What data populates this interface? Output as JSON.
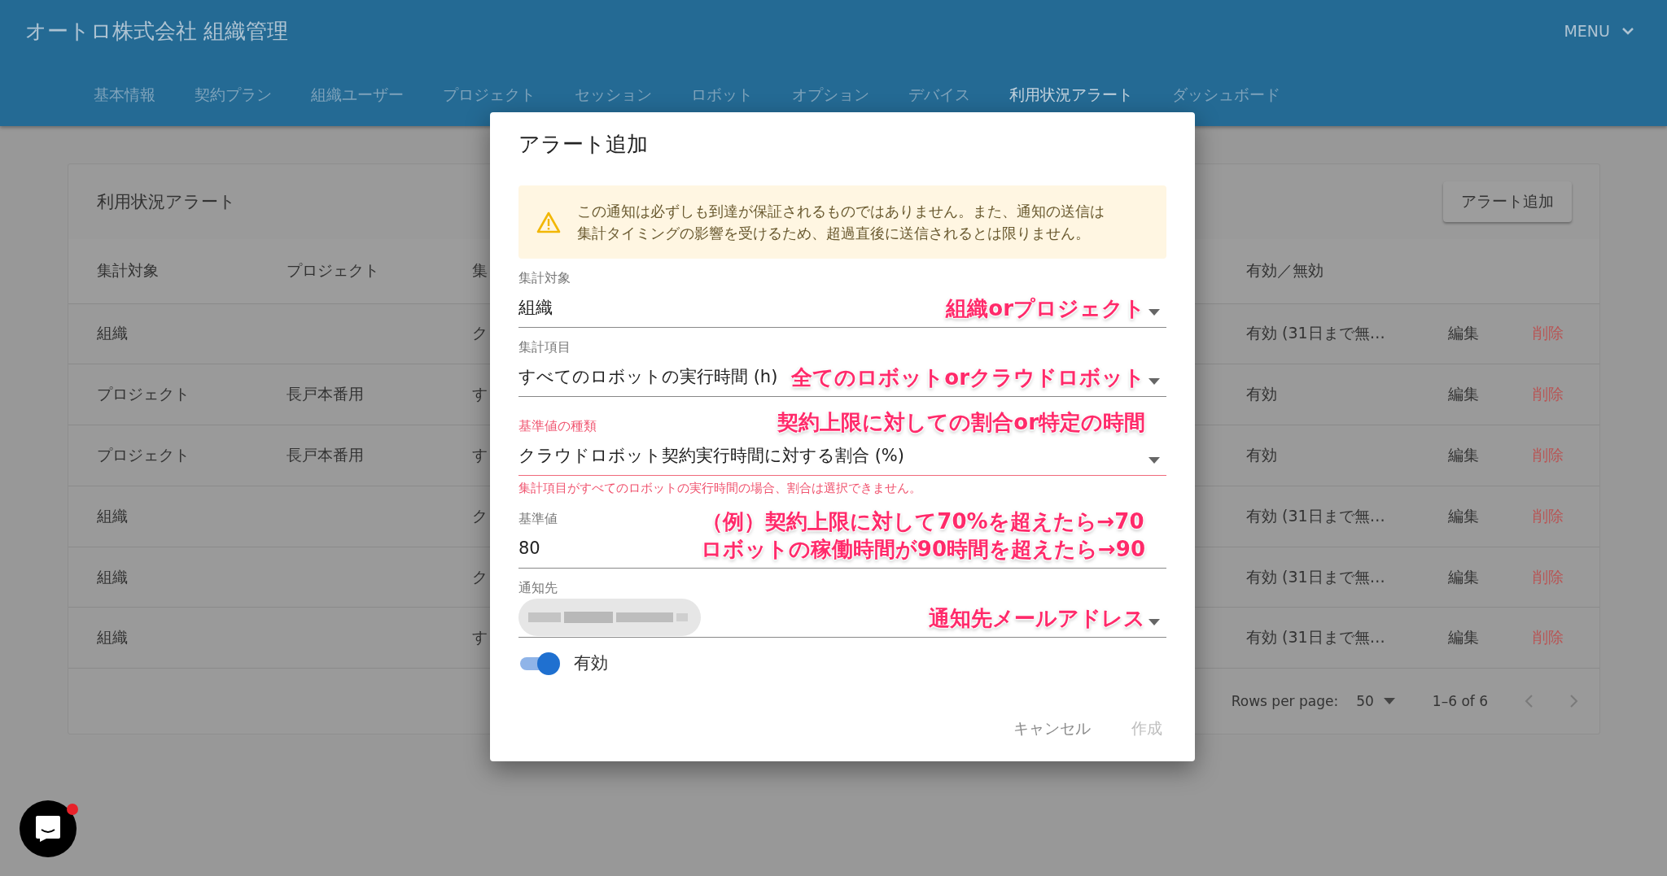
{
  "header": {
    "title": "オートロ株式会社 組織管理",
    "menu": "MENU"
  },
  "tabs": [
    {
      "label": "基本情報",
      "selected": false
    },
    {
      "label": "契約プラン",
      "selected": false
    },
    {
      "label": "組織ユーザー",
      "selected": false
    },
    {
      "label": "プロジェクト",
      "selected": false
    },
    {
      "label": "セッション",
      "selected": false
    },
    {
      "label": "ロボット",
      "selected": false
    },
    {
      "label": "オプション",
      "selected": false
    },
    {
      "label": "デバイス",
      "selected": false
    },
    {
      "label": "利用状況アラート",
      "selected": true
    },
    {
      "label": "ダッシュボード",
      "selected": false
    }
  ],
  "card": {
    "title": "利用状況アラート",
    "add_button": "アラート追加"
  },
  "table": {
    "columns": [
      "集計対象",
      "プロジェクト",
      "集",
      "有効／無効"
    ],
    "rows": [
      {
        "target": "組織",
        "column_3": "ク",
        "status": "有効 (31日まで無…",
        "edit": "編集",
        "delete": "削除"
      },
      {
        "target": "プロジェクト",
        "project": "長戸本番用",
        "column_3": "す",
        "status": "有効",
        "edit": "編集",
        "delete": "削除"
      },
      {
        "target": "プロジェクト",
        "project": "長戸本番用",
        "column_3": "す",
        "status": "有効",
        "edit": "編集",
        "delete": "削除"
      },
      {
        "target": "組織",
        "column_3": "ク",
        "status": "有効 (31日まで無…",
        "edit": "編集",
        "delete": "削除"
      },
      {
        "target": "組織",
        "column_3": "ク",
        "status": "有効 (31日まで無…",
        "edit": "編集",
        "delete": "削除"
      },
      {
        "target": "組織",
        "column_3": "す",
        "status": "有効 (31日まで無…",
        "edit": "編集",
        "delete": "削除"
      }
    ]
  },
  "pagination": {
    "rows_per_page_label": "Rows per page:",
    "rows_per_page": "50",
    "range": "1–6 of 6"
  },
  "dialog": {
    "title": "アラート追加",
    "warning": [
      "この通知は必ずしも到達が保証されるものではありません。また、通知の送信は",
      "集計タイミングの影響を受けるため、超過直後に送信されるとは限りません。"
    ],
    "fields": [
      {
        "kind": "select",
        "label": "集計対象",
        "value": "組織",
        "annotation": [
          "組織orプロジェクト"
        ]
      },
      {
        "kind": "select",
        "label": "集計項目",
        "value": "すべてのロボットの実行時間 (h)",
        "annotation": [
          "全てのロボットorクラウドロボット"
        ]
      },
      {
        "kind": "select",
        "label": "基準値の種類",
        "value": "クラウドロボット契約実行時間に対する割合 (%)",
        "error": "集計項目がすべてのロボットの実行時間の場合、割合は選択できません。",
        "annotation": [
          "契約上限に対しての割合or特定の時間"
        ]
      },
      {
        "kind": "text",
        "label": "基準値",
        "value": "80",
        "annotation": [
          "（例）契約上限に対して70%を超えたら→70",
          "ロボットの稼働時間が90時間を超えたら→90"
        ]
      },
      {
        "kind": "chips",
        "label": "通知先",
        "chips": [
          {
            "kind": "redacted"
          }
        ],
        "annotation": [
          "通知先メールアドレス"
        ]
      }
    ],
    "switch": {
      "label": "有効",
      "on": true
    },
    "actions": [
      {
        "label": "キャンセル",
        "disabled": false
      },
      {
        "label": "作成",
        "disabled": true
      }
    ]
  },
  "chat": {
    "unread": true
  }
}
